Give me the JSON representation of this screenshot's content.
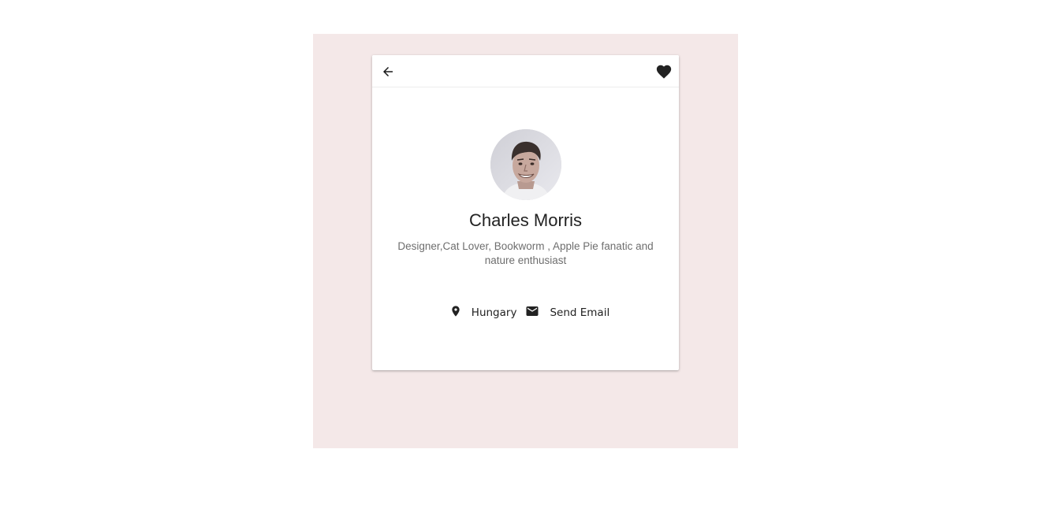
{
  "toolbar": {
    "back_icon": "arrow-back-icon",
    "favorite_icon": "heart-icon"
  },
  "profile": {
    "name": "Charles Morris",
    "bio": "Designer,Cat Lover, Bookworm , Apple Pie fanatic and nature enthusiast",
    "location_icon": "location-pin-icon",
    "location": "Hungary",
    "email_icon": "mail-icon",
    "email_label": "Send Email"
  },
  "colors": {
    "backdrop": "#f4e8e8",
    "card": "#ffffff",
    "text_primary": "#222222",
    "text_secondary": "#6e6e6e"
  }
}
